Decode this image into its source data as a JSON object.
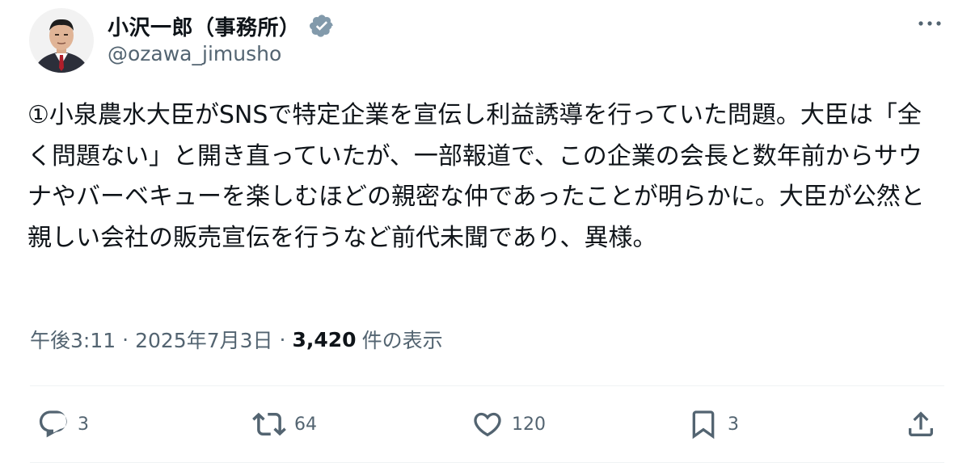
{
  "user": {
    "display_name": "小沢一郎（事務所）",
    "handle": "@ozawa_jimusho",
    "verified": true
  },
  "tweet": {
    "text": "①小泉農水大臣がSNSで特定企業を宣伝し利益誘導を行っていた問題。大臣は「全く問題ない」と開き直っていたが、一部報道で、この企業の会長と数年前からサウナやバーベキューを楽しむほどの親密な仲であったことが明らかに。大臣が公然と親しい会社の販売宣伝を行うなど前代未聞であり、異様。"
  },
  "meta": {
    "time": "午後3:11",
    "separator": "·",
    "date": "2025年7月3日",
    "views_count": "3,420",
    "views_label": "件の表示"
  },
  "actions": {
    "reply_count": "3",
    "retweet_count": "64",
    "like_count": "120",
    "bookmark_count": "3"
  },
  "icons": {
    "verified": "verified-badge-icon",
    "more": "more-dots-icon",
    "reply": "reply-icon",
    "retweet": "retweet-icon",
    "like": "heart-icon",
    "bookmark": "bookmark-icon",
    "share": "share-icon"
  },
  "colors": {
    "text_primary": "#0f1419",
    "text_secondary": "#536471",
    "divider": "#eff3f4",
    "verified_badge": "#829aab"
  }
}
